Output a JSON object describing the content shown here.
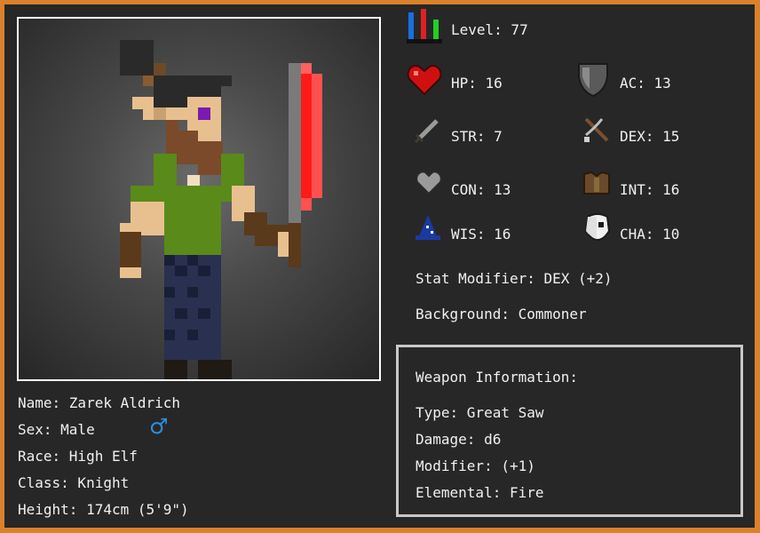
{
  "character": {
    "name_line": "Name: Zarek Aldrich",
    "sex_line": "Sex: Male",
    "sex_symbol": "♂",
    "race_line": "Race: High Elf",
    "class_line": "Class: Knight",
    "height_line": "Height: 174cm (5'9\")"
  },
  "stats": {
    "level": "Level: 77",
    "hp": "HP: 16",
    "ac": "AC: 13",
    "str": "STR: 7",
    "dex": "DEX: 15",
    "con": "CON: 13",
    "int": "INT: 16",
    "wis": "WIS: 16",
    "cha": "CHA: 10",
    "stat_modifier": "Stat Modifier: DEX (+2)",
    "background": "Background: Commoner"
  },
  "weapon": {
    "heading": "Weapon Information:",
    "type": "Type: Great Saw",
    "damage": "Damage: d6",
    "modifier": "Modifier: (+1)",
    "elemental": "Elemental: Fire"
  },
  "icons": {
    "level": "level-bars-icon",
    "hp": "heart-icon",
    "ac": "shield-icon",
    "str": "sword-icon",
    "dex": "crossbow-icon",
    "con": "gray-heart-icon",
    "int": "armor-icon",
    "wis": "wizard-hat-icon",
    "cha": "skull-mask-icon",
    "sex": "male-symbol-icon"
  },
  "colors": {
    "border": "#d9822b",
    "panel": "#272727",
    "male_symbol": "#2a8fe0",
    "blade_fire": "#ff1a1a"
  }
}
